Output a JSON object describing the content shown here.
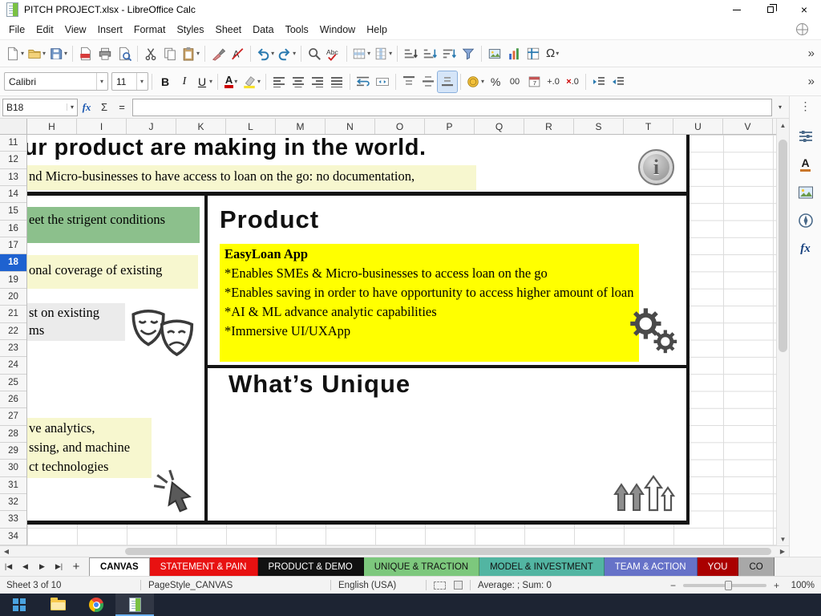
{
  "window": {
    "title": "PITCH  PROJECT.xlsx - LibreOffice Calc"
  },
  "menu": {
    "items": [
      "File",
      "Edit",
      "View",
      "Insert",
      "Format",
      "Styles",
      "Sheet",
      "Data",
      "Tools",
      "Window",
      "Help"
    ]
  },
  "toolbar": {
    "font_name": "Calibri",
    "font_size": "11"
  },
  "formula_bar": {
    "cell_ref": "B18",
    "value": ""
  },
  "grid": {
    "col_headers": [
      "H",
      "I",
      "J",
      "K",
      "L",
      "M",
      "N",
      "O",
      "P",
      "Q",
      "R",
      "S",
      "T",
      "U",
      "V"
    ],
    "rows": [
      "11",
      "12",
      "13",
      "14",
      "15",
      "16",
      "17",
      "18",
      "19",
      "20",
      "21",
      "22",
      "23",
      "24",
      "25",
      "26",
      "27",
      "28",
      "29",
      "30",
      "31",
      "32",
      "33",
      "34"
    ],
    "active_row": "18"
  },
  "canvas": {
    "headline": "ur product are making in the world.",
    "note_top": "nd Micro-businesses to have access to loan on the go: no documentation,",
    "note_green": "eet the strigent conditions",
    "note_coverage": "onal coverage of existing",
    "note_gray": [
      "st on existing",
      "ms"
    ],
    "note_tech": [
      "ve analytics,",
      "ssing, and machine",
      "ct technologies"
    ],
    "product": {
      "title": "Product",
      "app_name": "EasyLoan App",
      "bullets": [
        "*Enables SMEs & Micro-businesses to access loan on the go",
        "*Enables saving in order to have opportunity to access higher amount of loan",
        "*AI & ML advance analytic capabilities",
        "*Immersive UI/UXApp"
      ]
    },
    "unique_title": "What’s Unique"
  },
  "sheet_tabs": [
    {
      "label": "CANVAS",
      "bg": "#ffffff",
      "fg": "#000000",
      "active": true
    },
    {
      "label": "STATEMENT & PAIN",
      "bg": "#e81111",
      "fg": "#ffffff",
      "active": false
    },
    {
      "label": "PRODUCT & DEMO",
      "bg": "#111111",
      "fg": "#ffffff",
      "active": false
    },
    {
      "label": "UNIQUE & TRACTION",
      "bg": "#7dc87d",
      "fg": "#111111",
      "active": false
    },
    {
      "label": "MODEL & INVESTMENT",
      "bg": "#52b5a2",
      "fg": "#111111",
      "active": false
    },
    {
      "label": "TEAM & ACTION",
      "bg": "#6672c8",
      "fg": "#ffffff",
      "active": false
    },
    {
      "label": "YOU",
      "bg": "#aa0000",
      "fg": "#ffffff",
      "active": false
    },
    {
      "label": "CO",
      "bg": "#a8a8a8",
      "fg": "#111111",
      "active": false
    }
  ],
  "status_bar": {
    "sheet_info": "Sheet 3 of 10",
    "page_style": "PageStyle_CANVAS",
    "language": "English (USA)",
    "stats": "Average: ; Sum: 0",
    "zoom_level": "100%"
  },
  "icons": {
    "caret": "▾",
    "scroll_up": "▲",
    "scroll_down": "▼",
    "scroll_left": "◀",
    "scroll_right": "▶",
    "first_sheet": "|◀",
    "prev_sheet": "◀",
    "next_sheet": "▶",
    "last_sheet": "▶|",
    "plus": "+",
    "minus": "−",
    "more": "»",
    "sidebar_menu": "⋮",
    "omega": "Ω",
    "sum": "Σ",
    "equals": "=",
    "fx": "fx",
    "percent": "%",
    "number_format": "00",
    "add_decimal": "+.0",
    "del_decimal_mark": "×",
    "del_decimal": ".0",
    "bold": "B",
    "italic": "I",
    "underline": "U",
    "font_color_letter": "A",
    "styles_letter": "A",
    "info": "i",
    "close": "×"
  },
  "colors": {
    "active_row_header": "#1e62d0",
    "canvas_note_yellow": "#f7f7cf",
    "canvas_note_green": "#8cc08c",
    "canvas_note_gray": "#ebebeb",
    "product_highlight": "#ffff00",
    "taskbar": "#1d2433"
  },
  "taskbar": {
    "apps": [
      "start",
      "file-explorer",
      "chrome",
      "libreoffice-calc"
    ],
    "active_app": "libreoffice-calc"
  }
}
